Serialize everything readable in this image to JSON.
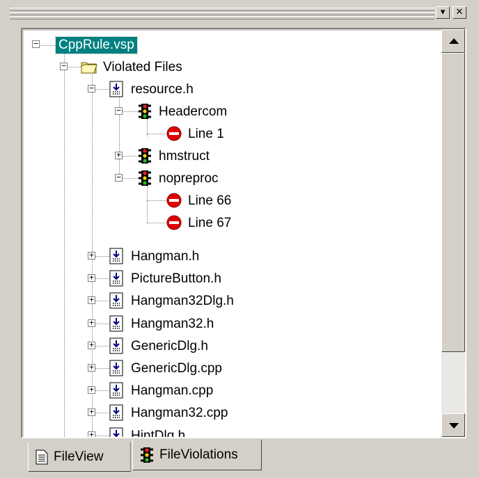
{
  "window": {
    "dropdown_glyph": "▾",
    "close_glyph": "✕"
  },
  "tree": {
    "root": {
      "label": "CppRule.vsp",
      "expanded": true,
      "selected": true
    },
    "folder": {
      "label": "Violated Files",
      "expanded": true,
      "icon": "folder-icon"
    },
    "resource": {
      "label": "resource.h",
      "expanded": true,
      "icon": "header-file-icon"
    },
    "rules": [
      {
        "label": "Headercom",
        "expanded": true,
        "icon": "traffic-light-icon"
      },
      {
        "label": "hmstruct",
        "expanded": false,
        "icon": "traffic-light-icon"
      },
      {
        "label": "nopreproc",
        "expanded": true,
        "icon": "traffic-light-icon"
      }
    ],
    "violations": [
      {
        "label": "Line 1",
        "icon": "stop-icon"
      },
      {
        "label": "Line 66",
        "icon": "stop-icon"
      },
      {
        "label": "Line 67",
        "icon": "stop-icon"
      }
    ],
    "files": [
      {
        "label": "Hangman.h"
      },
      {
        "label": "PictureButton.h"
      },
      {
        "label": "Hangman32Dlg.h"
      },
      {
        "label": "Hangman32.h"
      },
      {
        "label": "GenericDlg.h"
      },
      {
        "label": "GenericDlg.cpp"
      },
      {
        "label": "Hangman.cpp"
      },
      {
        "label": "Hangman32.cpp"
      },
      {
        "label": "HintDlg.h"
      }
    ]
  },
  "tabs": [
    {
      "label": "FileView",
      "icon": "document-icon",
      "active": false
    },
    {
      "label": "FileViolations",
      "icon": "traffic-light-icon",
      "active": true
    }
  ],
  "colors": {
    "selection": "#008080",
    "face": "#d4d0c8",
    "stop_red": "#e00000"
  }
}
